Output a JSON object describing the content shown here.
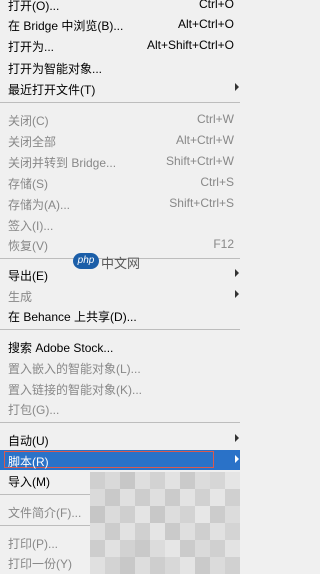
{
  "menu": {
    "items": [
      {
        "label": "打开(O)...",
        "shortcut": "Ctrl+O",
        "disabled": false
      },
      {
        "label": "在 Bridge 中浏览(B)...",
        "shortcut": "Alt+Ctrl+O",
        "disabled": false
      },
      {
        "label": "打开为...",
        "shortcut": "Alt+Shift+Ctrl+O",
        "disabled": false
      },
      {
        "label": "打开为智能对象...",
        "shortcut": "",
        "disabled": false
      },
      {
        "label": "最近打开文件(T)",
        "shortcut": "",
        "disabled": false,
        "submenu": true
      },
      {
        "label": "关闭(C)",
        "shortcut": "Ctrl+W",
        "disabled": true
      },
      {
        "label": "关闭全部",
        "shortcut": "Alt+Ctrl+W",
        "disabled": true
      },
      {
        "label": "关闭并转到 Bridge...",
        "shortcut": "Shift+Ctrl+W",
        "disabled": true
      },
      {
        "label": "存储(S)",
        "shortcut": "Ctrl+S",
        "disabled": true
      },
      {
        "label": "存储为(A)...",
        "shortcut": "Shift+Ctrl+S",
        "disabled": true
      },
      {
        "label": "签入(I)...",
        "shortcut": "",
        "disabled": true
      },
      {
        "label": "恢复(V)",
        "shortcut": "F12",
        "disabled": true
      },
      {
        "label": "导出(E)",
        "shortcut": "",
        "disabled": false,
        "submenu": true
      },
      {
        "label": "生成",
        "shortcut": "",
        "disabled": true,
        "submenu": true
      },
      {
        "label": "在 Behance 上共享(D)...",
        "shortcut": "",
        "disabled": false
      },
      {
        "label": "搜索 Adobe Stock...",
        "shortcut": "",
        "disabled": false
      },
      {
        "label": "置入嵌入的智能对象(L)...",
        "shortcut": "",
        "disabled": true
      },
      {
        "label": "置入链接的智能对象(K)...",
        "shortcut": "",
        "disabled": true
      },
      {
        "label": "打包(G)...",
        "shortcut": "",
        "disabled": true
      },
      {
        "label": "自动(U)",
        "shortcut": "",
        "disabled": false,
        "submenu": true
      },
      {
        "label": "脚本(R)",
        "shortcut": "",
        "disabled": false,
        "submenu": true,
        "highlighted": true
      },
      {
        "label": "导入(M)",
        "shortcut": "",
        "disabled": false,
        "submenu": true
      },
      {
        "label": "文件简介(F)...",
        "shortcut": "",
        "disabled": true
      },
      {
        "label": "打印(P)...",
        "shortcut": "",
        "disabled": true
      },
      {
        "label": "打印一份(Y)",
        "shortcut": "",
        "disabled": true
      }
    ]
  },
  "watermark": {
    "logo": "php",
    "text": "中文网"
  },
  "colors": {
    "highlight": "#2a72c8",
    "disabled_text": "#888888",
    "menu_bg": "#f0f0f0"
  }
}
